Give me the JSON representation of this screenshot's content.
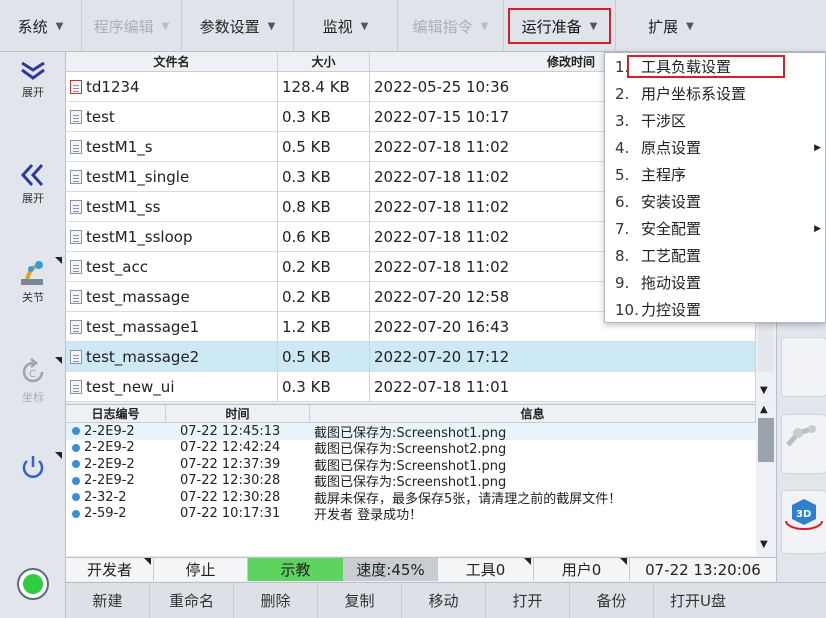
{
  "menubar": {
    "items": [
      {
        "label": "系统",
        "enabled": true
      },
      {
        "label": "程序编辑",
        "enabled": false
      },
      {
        "label": "参数设置",
        "enabled": true
      },
      {
        "label": "监视",
        "enabled": true
      },
      {
        "label": "编辑指令",
        "enabled": false
      },
      {
        "label": "运行准备",
        "enabled": true,
        "active": true
      },
      {
        "label": "扩展",
        "enabled": true
      }
    ]
  },
  "lefttoolbar": {
    "expand1": "展开",
    "expand2": "展开",
    "joint": "关节",
    "coord": "坐标"
  },
  "filetable": {
    "headers": [
      "文件名",
      "大小",
      "修改时间"
    ],
    "rows": [
      {
        "name": "td1234",
        "size": "128.4 KB",
        "time": "2022-05-25 10:36"
      },
      {
        "name": "test",
        "size": "0.3 KB",
        "time": "2022-07-15 10:17"
      },
      {
        "name": "testM1_s",
        "size": "0.5 KB",
        "time": "2022-07-18 11:02"
      },
      {
        "name": "testM1_single",
        "size": "0.3 KB",
        "time": "2022-07-18 11:02"
      },
      {
        "name": "testM1_ss",
        "size": "0.8 KB",
        "time": "2022-07-18 11:02"
      },
      {
        "name": "testM1_ssloop",
        "size": "0.6 KB",
        "time": "2022-07-18 11:02"
      },
      {
        "name": "test_acc",
        "size": "0.2 KB",
        "time": "2022-07-18 11:02"
      },
      {
        "name": "test_massage",
        "size": "0.2 KB",
        "time": "2022-07-20 12:58"
      },
      {
        "name": "test_massage1",
        "size": "1.2 KB",
        "time": "2022-07-20 16:43"
      },
      {
        "name": "test_massage2",
        "size": "0.5 KB",
        "time": "2022-07-20 17:12"
      },
      {
        "name": "test_new_ui",
        "size": "0.3 KB",
        "time": "2022-07-18 11:01"
      }
    ]
  },
  "logtable": {
    "headers": [
      "日志编号",
      "时间",
      "信息"
    ],
    "rows": [
      {
        "id": "2-2E9-2",
        "time": "07-22 12:45:13",
        "msg": "截图已保存为:Screenshot1.png"
      },
      {
        "id": "2-2E9-2",
        "time": "07-22 12:42:24",
        "msg": "截图已保存为:Screenshot2.png"
      },
      {
        "id": "2-2E9-2",
        "time": "07-22 12:37:39",
        "msg": "截图已保存为:Screenshot1.png"
      },
      {
        "id": "2-2E9-2",
        "time": "07-22 12:30:28",
        "msg": "截图已保存为:Screenshot1.png"
      },
      {
        "id": "2-32-2",
        "time": "07-22 12:30:28",
        "msg": "截屏未保存，最多保存5张，请清理之前的截屏文件！"
      },
      {
        "id": "2-59-2",
        "time": "07-22 10:17:31",
        "msg": "开发者 登录成功！"
      }
    ]
  },
  "status": {
    "user": "开发者",
    "state": "停止",
    "mode": "示教",
    "speed": "速度:45%",
    "tool": "工具0",
    "userframe": "用户0",
    "clock": "07-22 13:20:06",
    "mode_color": "#5fd35f"
  },
  "bottombar": {
    "buttons": [
      "新建",
      "重命名",
      "删除",
      "复制",
      "移动",
      "打开",
      "备份",
      "打开U盘"
    ]
  },
  "dropdown": {
    "items": [
      {
        "num": "1.",
        "label": "工具负载设置",
        "highlight": true,
        "submenu": false
      },
      {
        "num": "2.",
        "label": "用户坐标系设置",
        "submenu": false
      },
      {
        "num": "3.",
        "label": "干涉区",
        "submenu": false
      },
      {
        "num": "4.",
        "label": "原点设置",
        "submenu": true
      },
      {
        "num": "5.",
        "label": "主程序",
        "submenu": false
      },
      {
        "num": "6.",
        "label": "安装设置",
        "submenu": false
      },
      {
        "num": "7.",
        "label": "安全配置",
        "submenu": true
      },
      {
        "num": "8.",
        "label": "工艺配置",
        "submenu": false
      },
      {
        "num": "9.",
        "label": "拖动设置",
        "submenu": false
      },
      {
        "num": "10.",
        "label": "力控设置",
        "submenu": false
      }
    ]
  },
  "colors": {
    "highlight_red": "#d81e2a",
    "selected_row": "#cde9f6",
    "accent_blue": "#3c8fd6"
  }
}
